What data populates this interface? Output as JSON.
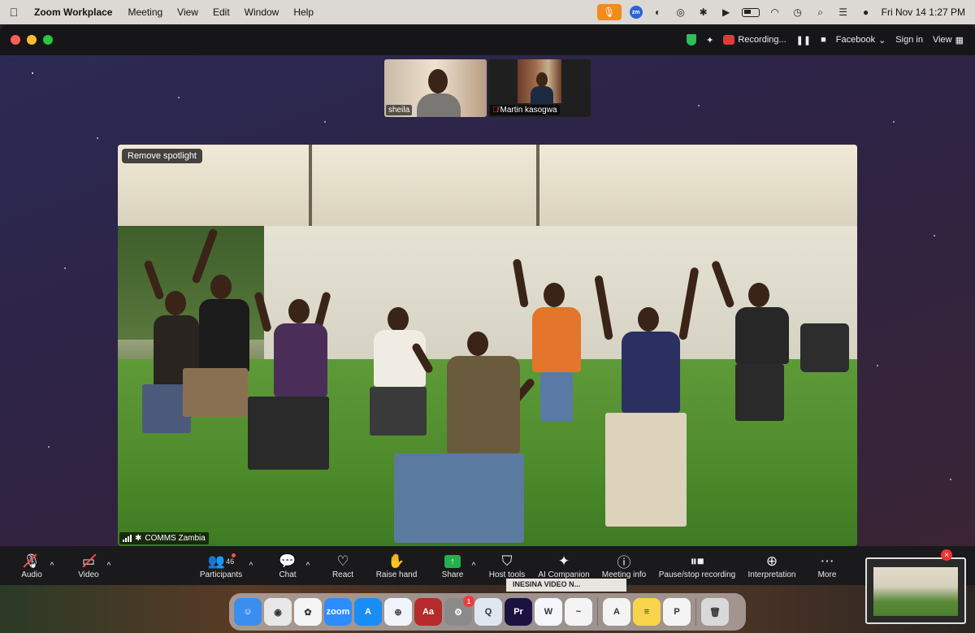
{
  "menubar": {
    "app_name": "Zoom Workplace",
    "items": [
      "Meeting",
      "View",
      "Edit",
      "Window",
      "Help"
    ],
    "zm_badge": "zm",
    "clock": "Fri Nov 14  1:27 PM"
  },
  "titlebar": {
    "recording_label": "Recording...",
    "facebook_label": "Facebook",
    "sign_in_label": "Sign in",
    "view_label": "View"
  },
  "thumbnails": [
    {
      "name": "sheila",
      "muted": false
    },
    {
      "name": "Martin kasogwa",
      "muted": true
    }
  ],
  "main_video": {
    "remove_spotlight_label": "Remove spotlight",
    "participant_label": "COMMS Zambia"
  },
  "toolbar": {
    "audio": "Audio",
    "video": "Video",
    "participants": "Participants",
    "participant_count": "46",
    "chat": "Chat",
    "react": "React",
    "raise_hand": "Raise hand",
    "share": "Share",
    "host_tools": "Host tools",
    "ai_companion": "AI Companion",
    "meeting_info": "Meeting info",
    "pause_stop_recording": "Pause/stop recording",
    "interpretation": "Interpretation",
    "more": "More"
  },
  "preview_tile_text": "INESINA VIDEO N...",
  "dock": {
    "apps": [
      {
        "name": "finder",
        "label": "☺",
        "color": "#3a8ef0"
      },
      {
        "name": "chrome",
        "label": "◉",
        "color": "#e8e8e8"
      },
      {
        "name": "photos",
        "label": "✿",
        "color": "#f5f5f5"
      },
      {
        "name": "zoom",
        "label": "zoom",
        "color": "#2d8cff"
      },
      {
        "name": "app-store",
        "label": "A",
        "color": "#1a8cf5"
      },
      {
        "name": "safari",
        "label": "⊕",
        "color": "#f0f4fa"
      },
      {
        "name": "dictionary",
        "label": "Aa",
        "color": "#b52b2b"
      },
      {
        "name": "system-settings",
        "label": "⚙",
        "color": "#8a8a8a",
        "badge": "1"
      },
      {
        "name": "quicktime",
        "label": "Q",
        "color": "#dfe8f2"
      },
      {
        "name": "premiere-pro",
        "label": "Pr",
        "color": "#1c1242"
      },
      {
        "name": "word",
        "label": "W",
        "color": "#f4f6fb"
      },
      {
        "name": "freeform",
        "label": "~",
        "color": "#f4f4f4"
      },
      {
        "name": "acrobat",
        "label": "A",
        "color": "#f4f4f4"
      },
      {
        "name": "notes",
        "label": "≡",
        "color": "#f7d44a"
      },
      {
        "name": "pdf-app",
        "label": "P",
        "color": "#f4f4f4"
      },
      {
        "name": "trash",
        "label": "🗑",
        "color": "#d9d9d9"
      }
    ]
  }
}
